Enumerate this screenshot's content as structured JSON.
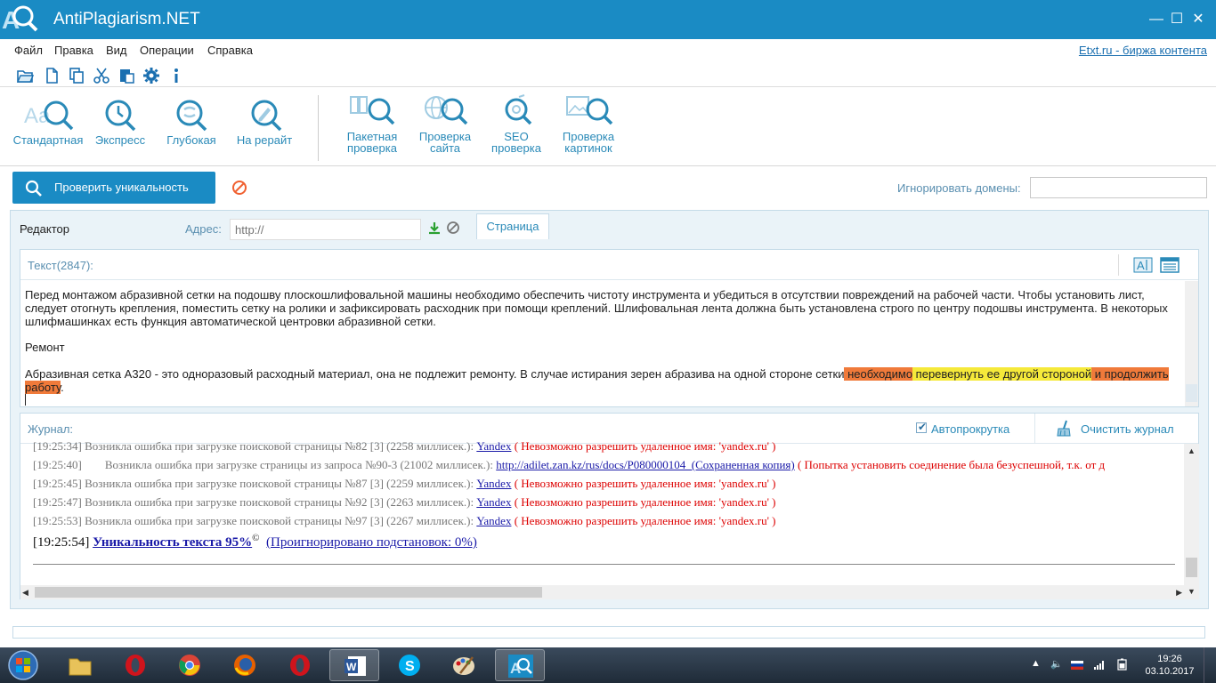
{
  "window": {
    "title": "AntiPlagiarism.NET",
    "controls": {
      "minimize": "—",
      "maximize": "☐",
      "close": "✕"
    }
  },
  "menu": {
    "items": [
      "Файл",
      "Правка",
      "Вид",
      "Операции",
      "Справка"
    ],
    "etxt_link": "Etxt.ru - биржа контента"
  },
  "quick_toolbar": [
    "folder-open-icon",
    "new-file-icon",
    "copy-icon",
    "cut-icon",
    "paste-icon",
    "settings-gear-icon",
    "info-icon"
  ],
  "ribbon": {
    "check_modes": [
      {
        "label": "Стандартная",
        "icon": "standard-check-icon"
      },
      {
        "label": "Экспресс",
        "icon": "express-clock-icon"
      },
      {
        "label": "Глубокая",
        "icon": "deep-check-icon"
      },
      {
        "label": "На рерайт",
        "icon": "rewrite-pencil-icon"
      }
    ],
    "tools": [
      {
        "line1": "Пакетная",
        "line2": "проверка",
        "icon": "batch-check-icon"
      },
      {
        "line1": "Проверка",
        "line2": "сайта",
        "icon": "site-check-globe-icon"
      },
      {
        "line1": "SEO",
        "line2": "проверка",
        "icon": "seo-check-icon"
      },
      {
        "line1": "Проверка",
        "line2": "картинок",
        "icon": "image-check-icon"
      }
    ]
  },
  "action_bar": {
    "check_button": "Проверить уникальность",
    "ignore_domains_label": "Игнорировать домены:",
    "ignore_domains_value": ""
  },
  "editor": {
    "tab_label": "Редактор",
    "address_label": "Адрес:",
    "address_placeholder": "http://",
    "page_tab": "Страница",
    "text_count": "Текст(2847):",
    "paragraph1": "Перед монтажом абразивной сетки на подошву плоскошлифовальной машины необходимо обеспечить чистоту инструмента и убедиться в отсутствии повреждений на рабочей части. Чтобы установить лист, следует отогнуть крепления, поместить сетку на ролики и зафиксировать расходник при помощи креплений. Шлифовальная лента должна быть установлена строго по центру подошвы инструмента. В некоторых шлифмашинках есть функция автоматической центровки абразивной сетки.",
    "heading": "Ремонт",
    "paragraph3_plain": "Абразивная сетка А320 - это одноразовый расходный материал, она не подлежит ремонту. В случае истирания зерен абразива на одной стороне сетки",
    "paragraph3_hl1": " необходимо",
    "paragraph3_hl2": " перевернуть ее другой стороной",
    "paragraph3_hl3": " и продолжить работу",
    "paragraph3_end": ".",
    "highlight_colors": {
      "orange": "#f07a3a",
      "yellow": "#f5e93a"
    }
  },
  "journal": {
    "label": "Журнал:",
    "autoscroll_label": "Автопрокрутка",
    "autoscroll_checked": true,
    "clear_label": "Очистить журнал",
    "lines": [
      {
        "time": "[19:25:34]",
        "text": " Возникла ошибка при загрузке поисковой страницы №82 [3] (2258 миллисек.): ",
        "link": "Yandex",
        "error": " ( Невозможно разрешить удаленное имя: 'yandex.ru' )"
      },
      {
        "time": "[19:25:40]",
        "text": "        Возникла ошибка при загрузке страницы из запроса №90-3 (21002 миллисек.): ",
        "link": "http://adilet.zan.kz/rus/docs/P080000104_(Сохраненная копия)",
        "error": " ( Попытка установить соединение была безуспешной, т.к. от д"
      },
      {
        "time": "[19:25:45]",
        "text": " Возникла ошибка при загрузке поисковой страницы №87 [3] (2259 миллисек.): ",
        "link": "Yandex",
        "error": " ( Невозможно разрешить удаленное имя: 'yandex.ru' )"
      },
      {
        "time": "[19:25:47]",
        "text": " Возникла ошибка при загрузке поисковой страницы №92 [3] (2263 миллисек.): ",
        "link": "Yandex",
        "error": " ( Невозможно разрешить удаленное имя: 'yandex.ru' )"
      },
      {
        "time": "[19:25:53]",
        "text": " Возникла ошибка при загрузке поисковой страницы №97 [3] (2267 миллисек.): ",
        "link": "Yandex",
        "error": " ( Невозможно разрешить удаленное имя: 'yandex.ru' )"
      }
    ],
    "final": {
      "time": "[19:25:54]",
      "uniqueness": "Уникальность текста 95%",
      "sup": "©",
      "ignored": "(Проигнорировано подстановок: 0%)"
    }
  },
  "taskbar": {
    "apps": [
      "explorer-icon",
      "opera-icon",
      "chrome-icon",
      "firefox-icon",
      "opera-icon",
      "word-icon",
      "skype-icon",
      "paint-icon",
      "antiplagiarism-icon"
    ],
    "active_app": "antiplagiarism-icon",
    "tray_lang": "RU",
    "time": "19:26",
    "date": "03.10.2017"
  },
  "colors": {
    "accent": "#1a8bc4",
    "link": "#1a1aa8",
    "error": "#dd0000"
  }
}
